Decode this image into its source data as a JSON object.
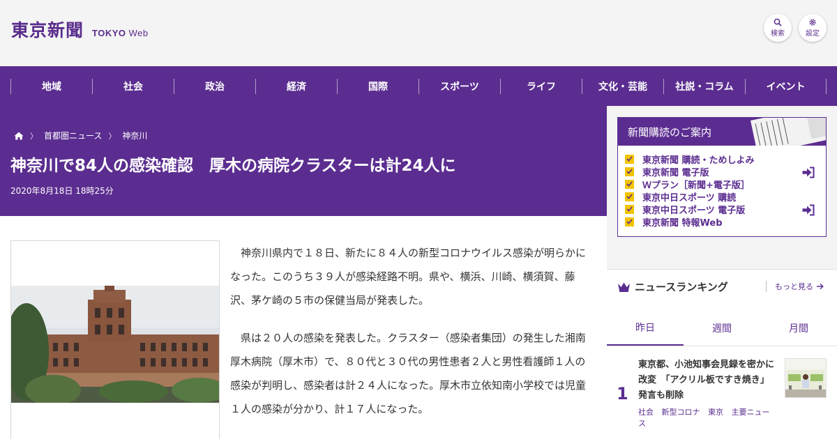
{
  "header": {
    "logo_jp": "東京新聞",
    "logo_en_bold": "TOKYO",
    "logo_en_light": " Web",
    "search_label": "検索",
    "settings_label": "設定"
  },
  "nav": {
    "items": [
      "地域",
      "社会",
      "政治",
      "経済",
      "国際",
      "スポーツ",
      "ライフ",
      "文化・芸能",
      "社説・コラム",
      "イベント"
    ]
  },
  "article": {
    "breadcrumb": [
      "首都圏ニュース",
      "神奈川"
    ],
    "title": "神奈川で84人の感染確認　厚木の病院クラスターは計24人に",
    "date": "2020年8月18日 18時25分",
    "paragraphs": [
      "神奈川県内で１８日、新たに８４人の新型コロナウイルス感染が明らかになった。このうち３９人が感染経路不明。県や、横浜、川崎、横須賀、藤沢、茅ケ崎の５市の保健当局が発表した。",
      "県は２０人の感染を発表した。クラスター（感染者集団）の発生した湘南厚木病院（厚木市）で、８０代と３０代の男性患者２人と男性看護師１人の感染が判明し、感染者は計２４人になった。厚木市立依知南小学校では児童１人の感染が分かり、計１７人になった。"
    ]
  },
  "subscription": {
    "heading": "新聞購読のご案内",
    "items": [
      "東京新聞 購読・ためしよみ",
      "東京新聞 電子版",
      "Ｗプラン［新聞+電子版］",
      "東京中日スポーツ 購読",
      "東京中日スポーツ 電子版",
      "東京新聞 特報Web"
    ]
  },
  "ranking": {
    "title": "ニュースランキング",
    "more": "もっと見る",
    "tabs": [
      "昨日",
      "週間",
      "月間"
    ],
    "active_tab": "昨日",
    "items": [
      {
        "rank": "1",
        "headline": "東京都、小池知事会見録を密かに改変　「アクリル板ですき焼き」発言も削除",
        "tags": [
          "社会",
          "新型コロナ",
          "東京",
          "主要ニュース"
        ]
      }
    ]
  },
  "colors": {
    "brand_purple": "#5b2d90",
    "check_yellow": "#f2c300"
  },
  "icons": [
    "search-icon",
    "gear-icon",
    "home-icon",
    "login-arrow-icon",
    "crown-icon",
    "arrow-right-icon",
    "check-icon"
  ]
}
